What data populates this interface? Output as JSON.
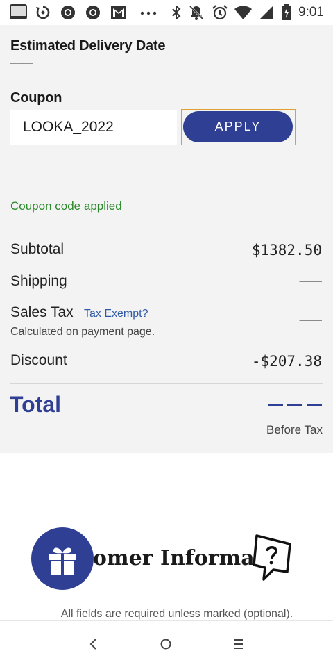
{
  "status_bar": {
    "time": "9:01",
    "icons": [
      "app-notification-icon",
      "sync-icon",
      "chrome-icon",
      "chrome-icon",
      "gmail-icon",
      "more-dots-icon",
      "bluetooth-icon",
      "notifications-off-icon",
      "alarm-icon",
      "wifi-icon",
      "signal-icon",
      "battery-icon"
    ]
  },
  "delivery": {
    "label": "Estimated Delivery Date",
    "value": "———"
  },
  "coupon": {
    "label": "Coupon",
    "input_value": "LOOKA_2022",
    "apply_label": "APPLY",
    "status": "Coupon code applied"
  },
  "summary": {
    "subtotal_label": "Subtotal",
    "subtotal_value": "$1382.50",
    "shipping_label": "Shipping",
    "shipping_value": "———",
    "sales_tax_label": "Sales Tax",
    "tax_exempt_link": "Tax Exempt?",
    "sales_tax_note": "Calculated on payment page.",
    "sales_tax_value": "———",
    "discount_label": "Discount",
    "discount_value": "-$207.38",
    "total_label": "Total",
    "before_tax": "Before Tax"
  },
  "customer_info": {
    "title": "tomer Informa    n",
    "required_note": "All fields are required unless marked (optional)."
  },
  "colors": {
    "brand_blue": "#2f3f94",
    "success_green": "#2a8a2a",
    "link_blue": "#2f5aa8",
    "panel_gray": "#f3f3f3"
  }
}
